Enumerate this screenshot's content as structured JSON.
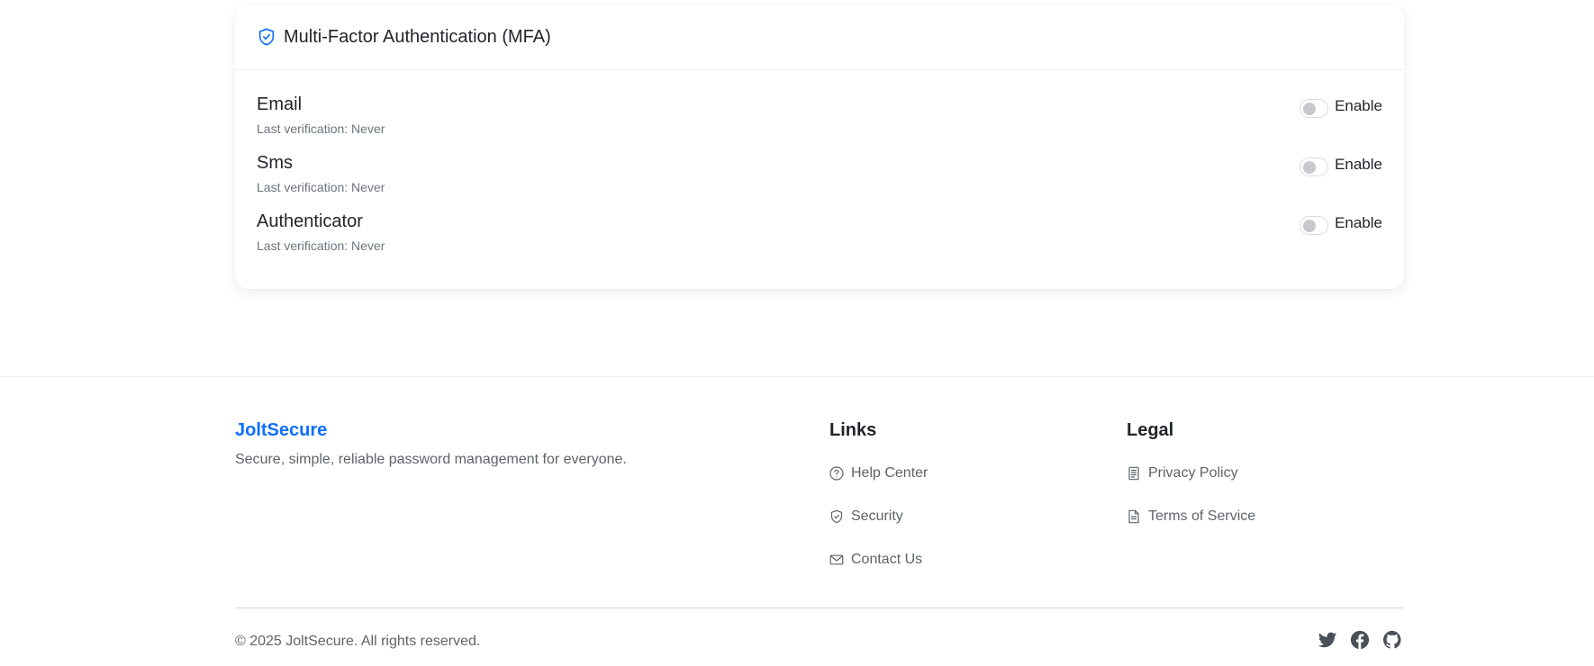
{
  "mfa": {
    "title": "Multi-Factor Authentication (MFA)",
    "icon": "shield-check-icon",
    "methods": [
      {
        "name": "Email",
        "status": "Last verification: Never",
        "toggle_label": "Enable",
        "enabled": false
      },
      {
        "name": "Sms",
        "status": "Last verification: Never",
        "toggle_label": "Enable",
        "enabled": false
      },
      {
        "name": "Authenticator",
        "status": "Last verification: Never",
        "toggle_label": "Enable",
        "enabled": false
      }
    ]
  },
  "footer": {
    "brand": "JoltSecure",
    "tagline": "Secure, simple, reliable password management for everyone.",
    "links_title": "Links",
    "links": [
      {
        "label": "Help Center",
        "icon": "question-circle-icon"
      },
      {
        "label": "Security",
        "icon": "shield-icon"
      },
      {
        "label": "Contact Us",
        "icon": "envelope-icon"
      }
    ],
    "legal_title": "Legal",
    "legal": [
      {
        "label": "Privacy Policy",
        "icon": "document-text-icon"
      },
      {
        "label": "Terms of Service",
        "icon": "document-icon"
      }
    ],
    "copyright": "© 2025 JoltSecure. All rights reserved.",
    "social": [
      "twitter-icon",
      "facebook-icon",
      "github-icon"
    ]
  },
  "colors": {
    "accent": "#0d6efd",
    "text": "#212529",
    "muted": "#6c757d",
    "toggle_knob": "#c7c9cc"
  }
}
